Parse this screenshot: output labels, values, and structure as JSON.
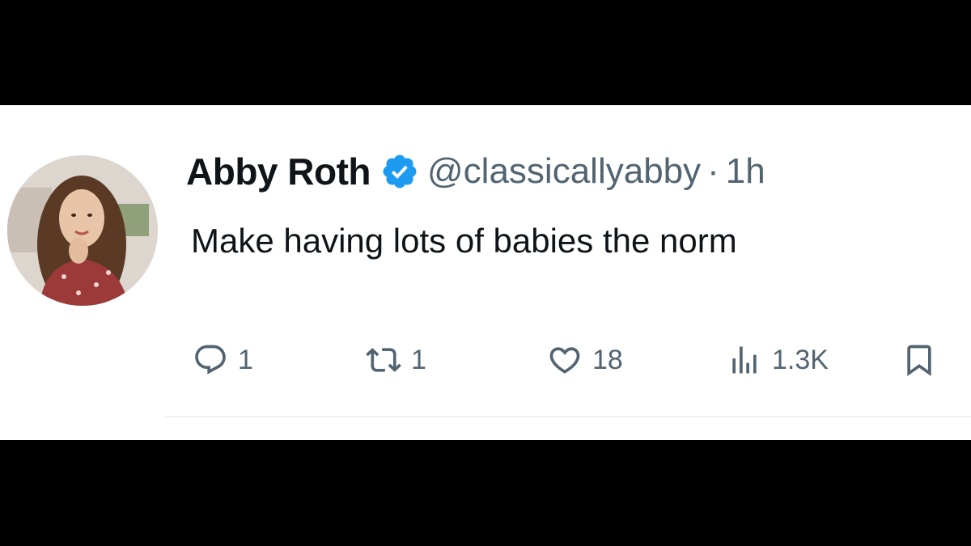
{
  "tweet": {
    "display_name": "Abby Roth",
    "handle": "@classicallyabby",
    "separator": "·",
    "time": "1h",
    "text": "Make having lots of babies the norm",
    "verified_icon": "verified-badge-icon",
    "avatar": "profile-photo"
  },
  "actions": {
    "reply": {
      "icon": "reply-icon",
      "count": "1"
    },
    "retweet": {
      "icon": "retweet-icon",
      "count": "1"
    },
    "like": {
      "icon": "heart-icon",
      "count": "18"
    },
    "views": {
      "icon": "analytics-icon",
      "count": "1.3K"
    },
    "bookmark": {
      "icon": "bookmark-icon"
    }
  },
  "colors": {
    "text_primary": "#0f1419",
    "text_secondary": "#536471",
    "verified_blue": "#1d9bf0",
    "background": "#ffffff",
    "letterbox": "#000000"
  }
}
